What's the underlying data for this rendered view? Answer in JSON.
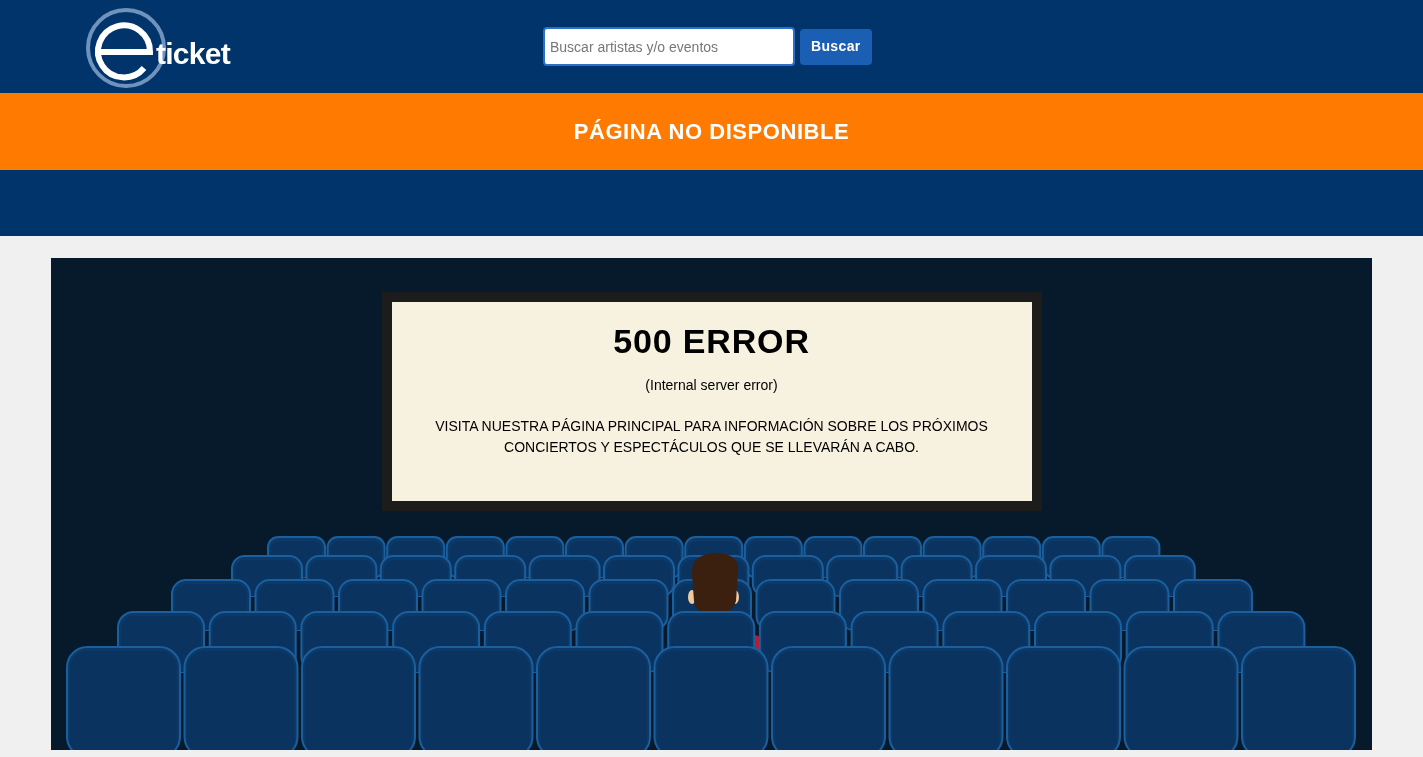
{
  "header": {
    "logo_text": "ticket",
    "search": {
      "placeholder": "Buscar artistas y/o eventos"
    },
    "search_button": "Buscar"
  },
  "banner": {
    "title": "PÁGINA NO DISPONIBLE"
  },
  "error_screen": {
    "heading": "500 ERROR",
    "subtitle": "(Internal server error)",
    "message": "VISITA NUESTRA PÁGINA PRINCIPAL PARA INFORMACIÓN SOBRE LOS PRÓXIMOS CONCIERTOS Y ESPECTÁCULOS QUE SE LLEVARÁN A CABO."
  }
}
